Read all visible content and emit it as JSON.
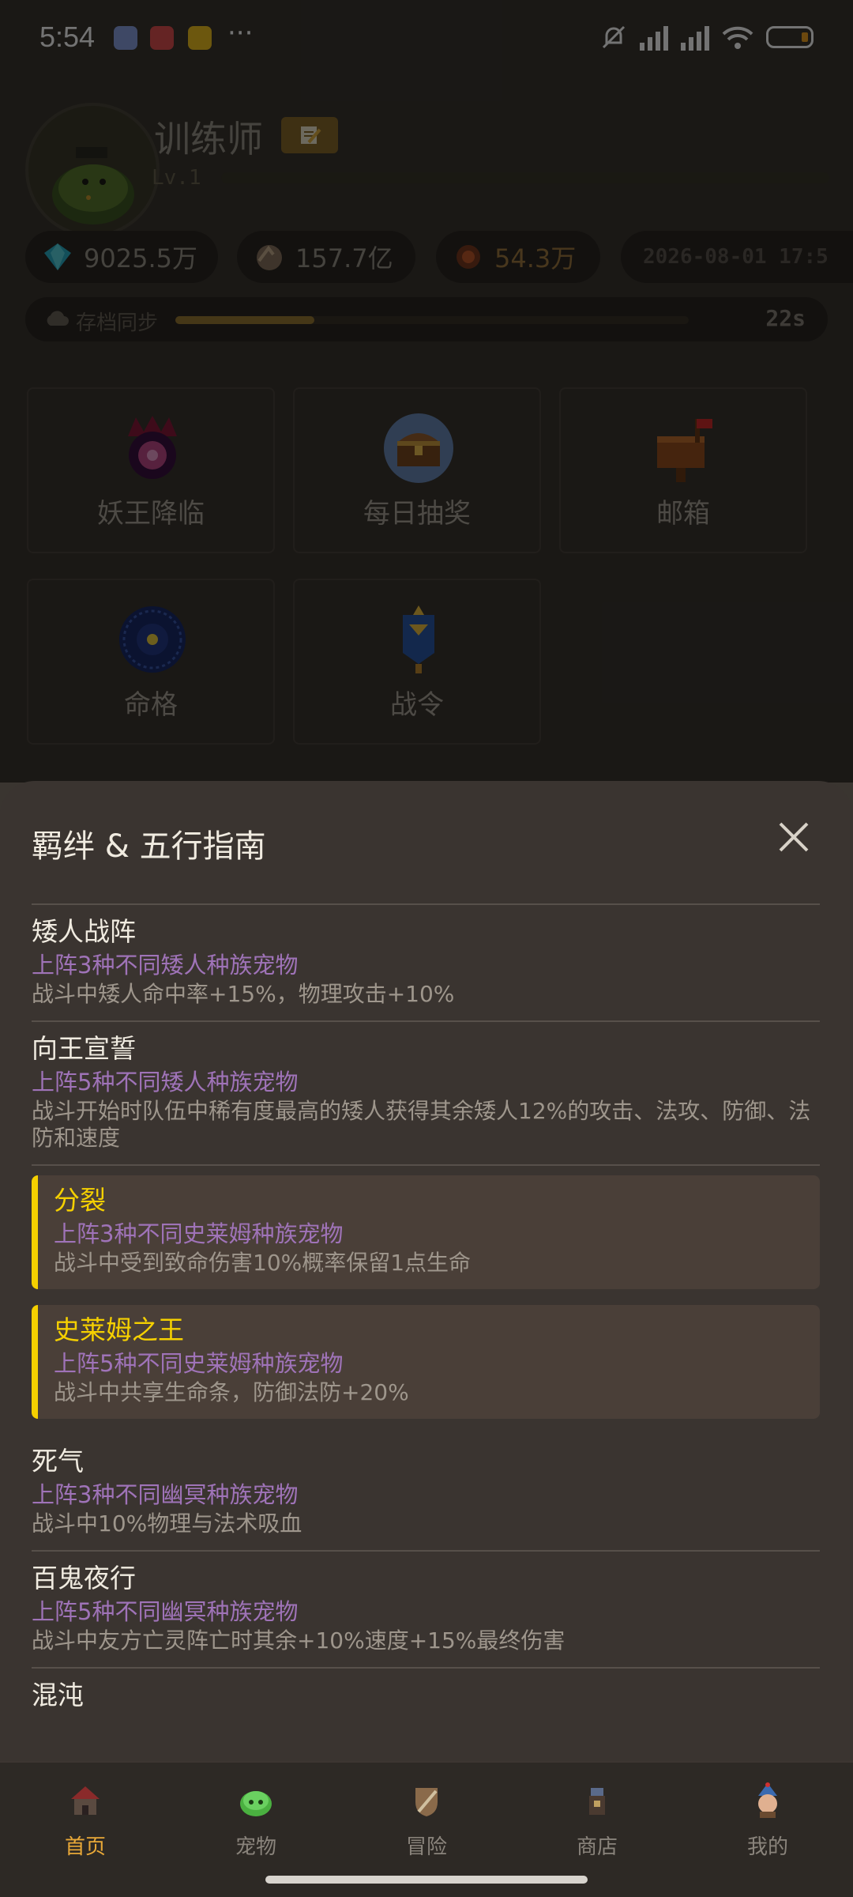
{
  "status": {
    "time": "5:54"
  },
  "profile": {
    "name": "训练师",
    "level": "Lv.1",
    "xp_fraction": 0.0
  },
  "currencies": [
    {
      "icon": "diamond-icon",
      "value": "9025.5万",
      "color": "#9a948a"
    },
    {
      "icon": "ore-icon",
      "value": "157.7亿",
      "color": "#9a948a"
    },
    {
      "icon": "fire-crystal-icon",
      "value": "54.3万",
      "color": "#a07a40"
    }
  ],
  "datetime_pill": "2026-08-01 17:5",
  "sync": {
    "label": "存档同步",
    "progress": 0.27,
    "countdown": "22s"
  },
  "features": [
    {
      "icon": "demon-king-icon",
      "label": "妖王降临"
    },
    {
      "icon": "treasure-chest-icon",
      "label": "每日抽奖"
    },
    {
      "icon": "mailbox-icon",
      "label": "邮箱"
    },
    {
      "icon": "fate-wheel-icon",
      "label": "命格"
    },
    {
      "icon": "battle-pass-icon",
      "label": "战令"
    }
  ],
  "sheet": {
    "title": "羁绊 & 五行指南",
    "bonds": [
      {
        "name": "矮人战阵",
        "req": "上阵3种不同矮人种族宠物",
        "effect": "战斗中矮人命中率+15%，物理攻击+10%",
        "highlight": false
      },
      {
        "name": "向王宣誓",
        "req": "上阵5种不同矮人种族宠物",
        "effect": "战斗开始时队伍中稀有度最高的矮人获得其余矮人12%的攻击、法攻、防御、法防和速度",
        "highlight": false
      },
      {
        "name": "分裂",
        "req": "上阵3种不同史莱姆种族宠物",
        "effect": "战斗中受到致命伤害10%概率保留1点生命",
        "highlight": true
      },
      {
        "name": "史莱姆之王",
        "req": "上阵5种不同史莱姆种族宠物",
        "effect": "战斗中共享生命条，防御法防+20%",
        "highlight": true
      },
      {
        "name": "死气",
        "req": "上阵3种不同幽冥种族宠物",
        "effect": "战斗中10%物理与法术吸血",
        "highlight": false
      },
      {
        "name": "百鬼夜行",
        "req": "上阵5种不同幽冥种族宠物",
        "effect": "战斗中友方亡灵阵亡时其余+10%速度+15%最终伤害",
        "highlight": false
      },
      {
        "name": "混沌",
        "req": "",
        "effect": "",
        "highlight": false
      }
    ]
  },
  "nav": [
    {
      "icon": "home-icon",
      "label": "首页",
      "active": true
    },
    {
      "icon": "pet-icon",
      "label": "宠物",
      "active": false
    },
    {
      "icon": "adventure-icon",
      "label": "冒险",
      "active": false
    },
    {
      "icon": "shop-icon",
      "label": "商店",
      "active": false
    },
    {
      "icon": "profile-icon",
      "label": "我的",
      "active": false
    }
  ]
}
